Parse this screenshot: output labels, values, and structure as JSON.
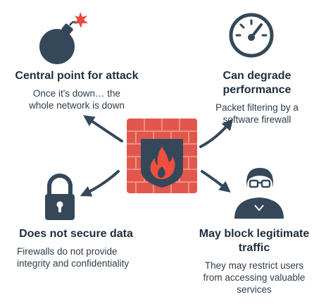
{
  "colors": {
    "dark": "#34485a",
    "brick": "#e2574c",
    "brick_light": "#ee7a6e",
    "flame": "#ef4f3c",
    "spark": "#e84a3c"
  },
  "icons": [
    "bomb-icon",
    "gauge-icon",
    "padlock-icon",
    "user-icon",
    "firewall-icon"
  ],
  "items": [
    {
      "title": "Central point for attack",
      "desc_lines": [
        "Once it's down… the",
        "whole network is down"
      ]
    },
    {
      "title_lines": [
        "Can degrade",
        "performance"
      ],
      "desc_lines": [
        "Packet filtering by a",
        "software firewall"
      ]
    },
    {
      "title": "Does not secure data",
      "desc_lines": [
        "Firewalls do not provide",
        "integrity and confidentiality"
      ]
    },
    {
      "title_lines": [
        "May block legitimate",
        "traffic"
      ],
      "desc_lines": [
        "They may restrict users",
        "from accessing valuable",
        "services"
      ]
    }
  ]
}
